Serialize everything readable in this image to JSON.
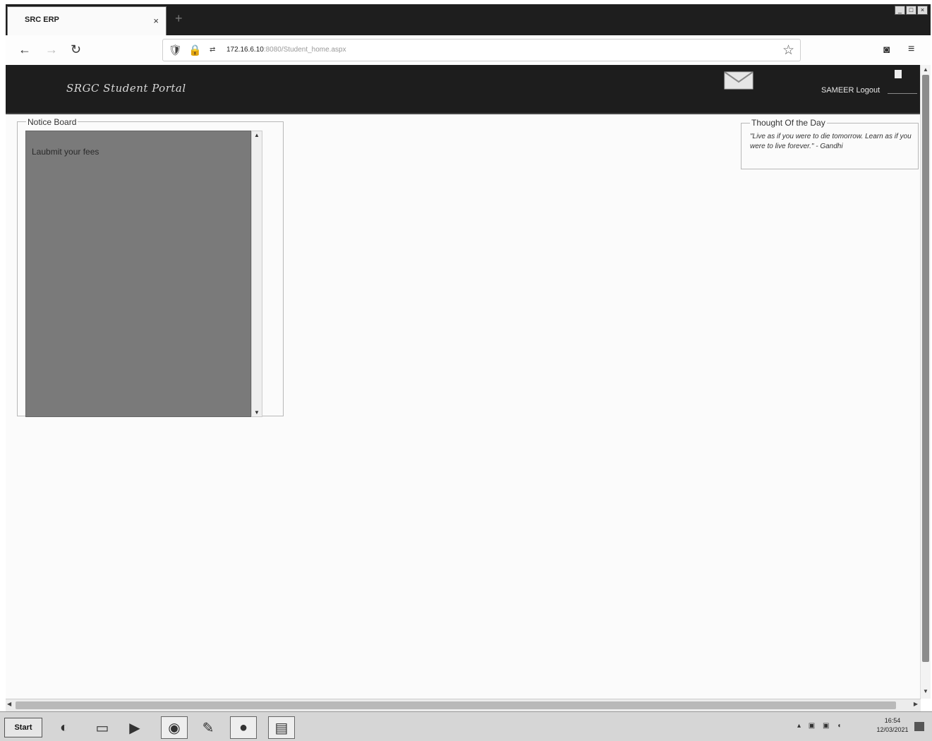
{
  "browser": {
    "tab_title": "SRC ERP",
    "tab_close": "×",
    "new_tab": "+",
    "window_controls": [
      "_",
      "□",
      "×"
    ],
    "url_prefix": "172.16.6.10",
    "url_rest": ":8080/Student_home.aspx",
    "icons": [
      "back-arrow-icon",
      "forward-arrow-icon",
      "reload-icon",
      "shield-icon",
      "lock-icon",
      "bookmark-star-icon",
      "pocket-icon",
      "menu-icon"
    ]
  },
  "header": {
    "portal_title": "SRGC Student Portal",
    "logout_text": "SAMEER Logout"
  },
  "notice_board": {
    "legend": "Notice Board",
    "text": "Laubmit your fees"
  },
  "thought": {
    "legend": "Thought Of the Day",
    "text": "\"Live as if you were to die tomorrow. Learn as if you were to live forever.\" - Gandhi"
  },
  "taskbar": {
    "start_label": "Start",
    "clock_time": "16:54",
    "clock_date": "12/03/2021"
  },
  "colors": {
    "header_bg": "#1d1d1d",
    "notice_box_bg": "#7a7a7a",
    "page_bg": "#fbfbfb"
  }
}
